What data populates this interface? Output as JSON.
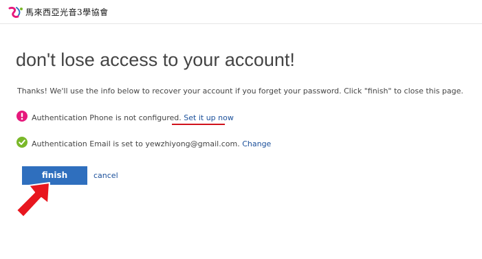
{
  "header": {
    "logo_text": "馬來西亞光音3學協會"
  },
  "page": {
    "title": "don't lose access to your account!",
    "intro": "Thanks! We'll use the info below to recover your account if you forget your password. Click \"finish\" to close this page."
  },
  "phone": {
    "status": "Authentication Phone is not configured.",
    "action_label": "Set it up now"
  },
  "email": {
    "status": "Authentication Email is set to yewzhiyong@gmail.com.",
    "action_label": "Change"
  },
  "actions": {
    "finish_label": "finish",
    "cancel_label": "cancel"
  },
  "icons": {
    "phone_status": "exclamation-circle-icon",
    "email_status": "check-circle-icon",
    "annotation": "red-arrow-icon"
  },
  "colors": {
    "accent": "#2f6fbe",
    "link": "#1a4f9a",
    "warning": "#e6197c",
    "success": "#7ab829",
    "annotation": "#d0121b"
  }
}
